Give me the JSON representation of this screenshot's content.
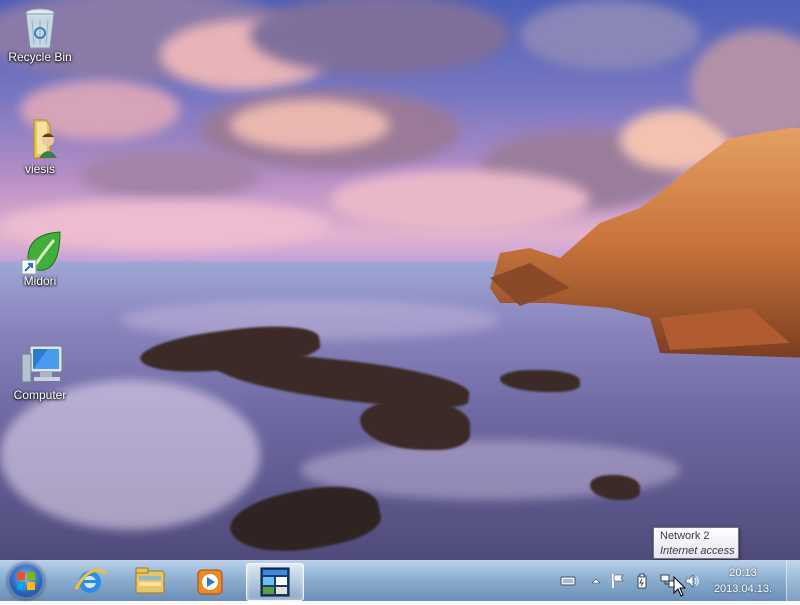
{
  "desktop": {
    "icons": [
      {
        "label": "Recycle Bin",
        "icon": "recycle-bin-icon"
      },
      {
        "label": "viesis",
        "icon": "user-folder-icon"
      },
      {
        "label": "Midori",
        "icon": "midori-browser-icon"
      },
      {
        "label": "Computer",
        "icon": "computer-icon"
      }
    ]
  },
  "taskbar": {
    "start_icon": "windows-start-orb",
    "pinned": [
      {
        "name": "Internet Explorer",
        "icon": "internet-explorer-icon"
      },
      {
        "name": "Windows Explorer",
        "icon": "file-explorer-icon"
      },
      {
        "name": "Windows Media Player",
        "icon": "media-player-icon"
      },
      {
        "name": "Active program",
        "icon": "application-window-icon",
        "active": true
      }
    ],
    "tray": {
      "icons": [
        "keyboard-icon",
        "show-hidden-icons-arrow",
        "action-center-flag-icon",
        "power-icon",
        "network-icon",
        "volume-icon"
      ],
      "time": "20:13",
      "date": "2013.04.13."
    }
  },
  "tooltip": {
    "line1": "Network  2",
    "line2": "Internet access"
  },
  "colors": {
    "taskbar": "#7aa2cc",
    "start_orb": "#2a63b8",
    "cliff": "#c8743a"
  }
}
